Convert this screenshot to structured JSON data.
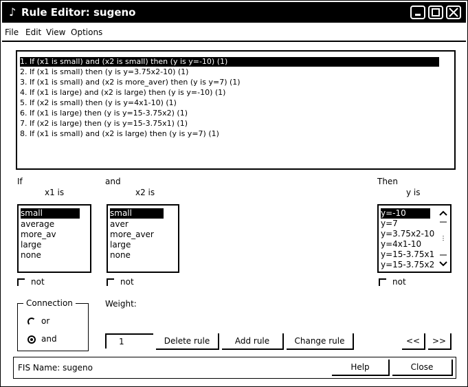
{
  "window": {
    "title": "Rule Editor: sugeno"
  },
  "menu": [
    "File",
    "Edit",
    "View",
    "Options"
  ],
  "rules": [
    "1. If (x1 is small) and (x2 is small) then (y is y=-10) (1)",
    "2. If (x1 is small) then (y is y=3.75x2-10) (1)",
    "3. If (x1 is small) and (x2 is more_aver) then (y is y=7) (1)",
    "4. If (x1 is large) and (x2 is large) then (y is y=-10) (1)",
    "5. If (x2 is small) then (y is y=4x1-10) (1)",
    "6. If (x1 is large) then (y is y=15-3.75x2) (1)",
    "7. If (x2 is large) then (y is y=15-3.75x1) (1)",
    "8. If (x1 is small) and (x2 is large) then (y is y=7) (1)"
  ],
  "labels": {
    "if": "If",
    "and": "and",
    "then": "Then",
    "x1": "x1 is",
    "x2": "x2 is",
    "y": "y is",
    "not": "not",
    "connection": "Connection",
    "or": "or",
    "and_radio": "and",
    "weight": "Weight:"
  },
  "x1_options": [
    "small",
    "average",
    "more_av",
    "large",
    "none"
  ],
  "x2_options": [
    "small",
    "aver",
    "more_aver",
    "large",
    "none"
  ],
  "y_options": [
    "y=-10",
    "y=7",
    "y=3.75x2-10",
    "y=4x1-10",
    "y=15-3.75x1",
    "y=15-3.75x2"
  ],
  "weight_value": "1",
  "buttons": {
    "delete": "Delete rule",
    "add": "Add rule",
    "change": "Change rule",
    "prev": "<<",
    "next": ">>",
    "help": "Help",
    "close": "Close"
  },
  "status": "FIS Name: sugeno"
}
